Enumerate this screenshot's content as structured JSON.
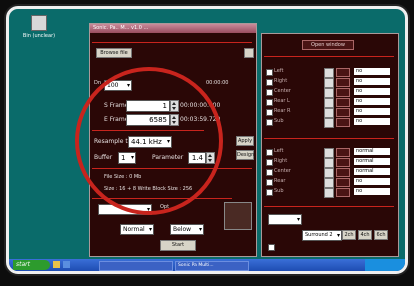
{
  "desktop": {
    "icon_label": "Bin (unclear)"
  },
  "main_window": {
    "title": "Sonic. Pa.. M... v1.0 ...",
    "browse_label": "Browse file",
    "dropdown_value": "100",
    "start_label": "1",
    "end_label": "6585",
    "field1": {
      "label": "S Frame",
      "value": "1",
      "time": "00:00:00.000"
    },
    "field2": {
      "label": "E Frame",
      "value": "6585",
      "time": "00:03:59.720"
    },
    "sample_label": "Resample to",
    "sample_value": "44.1 kHz",
    "buffer_label": "Buffer",
    "buffer_value": "1",
    "param_label": "Parameter",
    "param_value": "1.4",
    "btn_a": "Apply",
    "btn_b": "Design",
    "file_size": "File Size : 0 Mb",
    "fmt_line": "Size : 16 + 8  Write Block Size : 256",
    "normal": "Normal",
    "below": "Below",
    "start_button": "Start"
  },
  "right_panel": {
    "top_button": "Open window",
    "rows": [
      {
        "label": "Left",
        "value": "no"
      },
      {
        "label": "Right",
        "value": "no"
      },
      {
        "label": "Center",
        "value": "no"
      },
      {
        "label": "Rear L",
        "value": "no"
      },
      {
        "label": "Rear R",
        "value": "no"
      },
      {
        "label": "Sub",
        "value": "no"
      }
    ],
    "rows2": [
      {
        "label": "Left",
        "value": "normal"
      },
      {
        "label": "Right",
        "value": "normal"
      },
      {
        "label": "Center",
        "value": "normal"
      },
      {
        "label": "Rear",
        "value": "no"
      },
      {
        "label": "Sub",
        "value": "no"
      }
    ],
    "surround_value": "Surround 2",
    "b2": "2ch",
    "b4": "4ch",
    "b6": "6ch"
  },
  "taskbar": {
    "start": "start",
    "task1": "",
    "task2": "Sonic Pa Multi..."
  }
}
